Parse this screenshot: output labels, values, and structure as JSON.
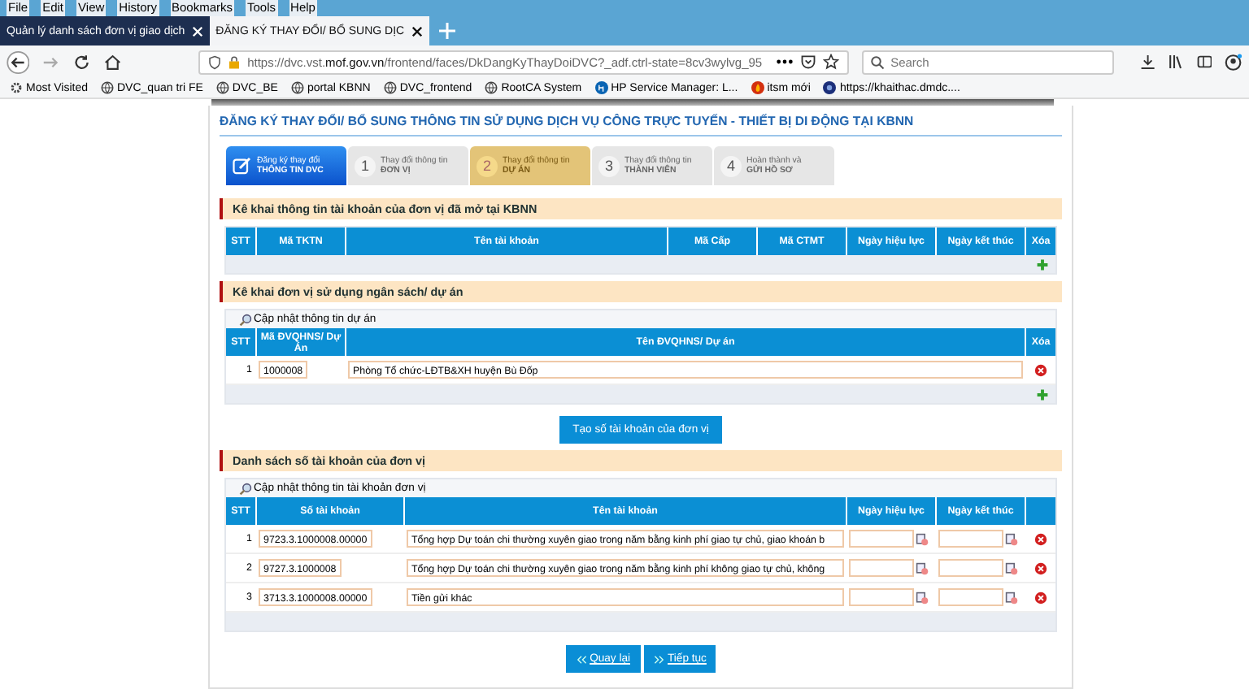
{
  "menu_bar": [
    "File",
    "Edit",
    "View",
    "History",
    "Bookmarks",
    "Tools",
    "Help"
  ],
  "tabs": [
    {
      "label": "Quản lý danh sách đơn vị giao dịch",
      "selected": false
    },
    {
      "label": "ĐĂNG KÝ THAY ĐỔI/ BỔ SUNG DỊC",
      "selected": true
    }
  ],
  "address_bar": {
    "url": "https://dvc.vst.**mof.gov.vn**/frontend/faces/DkDangKyThayDoiDVC?_adf.ctrl-state=8cv3wylvg_95"
  },
  "search": {
    "placeholder": "Search"
  },
  "bookmarks": [
    {
      "label": "Most Visited",
      "kind": "gear"
    },
    {
      "label": "DVC_quan tri FE",
      "kind": "globe"
    },
    {
      "label": "DVC_BE",
      "kind": "globe"
    },
    {
      "label": "portal KBNN",
      "kind": "globe"
    },
    {
      "label": "DVC_frontend",
      "kind": "globe"
    },
    {
      "label": "RootCA System",
      "kind": "globe"
    },
    {
      "label": "HP Service Manager: L...",
      "kind": "hp"
    },
    {
      "label": "itsm mới",
      "kind": "fire"
    },
    {
      "label": "https://khaithac.dmdc....",
      "kind": "dot"
    }
  ],
  "page_title": "ĐĂNG KÝ THAY ĐỔI/ BỔ SUNG THÔNG TIN SỬ DỤNG DỊCH VỤ CÔNG TRỰC TUYẾN - THIẾT BỊ DI ĐỘNG TẠI KBNN",
  "steps": [
    {
      "kind": "header",
      "line1": "Đăng ký thay đổi",
      "line2": "THÔNG TIN DVC",
      "selected": false
    },
    {
      "kind": "step",
      "number": "1",
      "line1": "Thay đổi thông tin",
      "line2": "ĐƠN VỊ",
      "selected": false
    },
    {
      "kind": "step",
      "number": "2",
      "line1": "Thay đổi thông tin",
      "line2": "DỰ ÁN",
      "selected": true
    },
    {
      "kind": "step",
      "number": "3",
      "line1": "Thay đổi thông tin",
      "line2": "THÀNH VIÊN",
      "selected": false
    },
    {
      "kind": "step",
      "number": "4",
      "line1": "Hoàn thành và",
      "line2": "GỬI HỒ SƠ",
      "selected": false
    }
  ],
  "sections": [
    {
      "title": "Kê khai thông tin tài khoản của đơn vị đã mở tại KBNN",
      "columns": [
        "STT",
        "Mã TKTN",
        "Tên tài khoản",
        "Mã Cấp",
        "Mã CTMT",
        "Ngày hiệu lực",
        "Ngày kết thúc",
        "Xóa"
      ],
      "addable": true
    },
    {
      "title": "Kê khai đơn vị sử dụng ngân sách/ dự án",
      "toolbar": "Cập nhật thông tin dự án",
      "columns": [
        "STT",
        "Mã ĐVQHNS/ Dự Án",
        "Tên ĐVQHNS/ Dự án",
        "Xóa"
      ],
      "rows": [
        {
          "stt": "1",
          "fields": [
            "1000008",
            "Phòng Tổ chức-LĐTB&XH huyện Bù Đốp"
          ]
        }
      ],
      "addable": true,
      "action": "Tạo số tài khoản của đơn vị"
    },
    {
      "title": "Danh sách số tài khoản của đơn vị",
      "toolbar": "Cập nhật thông tin tài khoản đơn vị",
      "columns": [
        "STT",
        "Số tài khoản",
        "Tên tài khoản",
        "Ngày hiệu lực",
        "Ngày kết thúc"
      ],
      "rows": [
        {
          "stt": "1",
          "fields": [
            "9723.3.1000008.00000",
            "Tổng hợp Dự toán chi thường xuyên giao trong năm bằng kinh phí giao tự chủ, giao khoán b"
          ]
        },
        {
          "stt": "2",
          "fields": [
            "9727.3.1000008",
            "Tổng hợp Dự toán chi thường xuyên giao trong năm bằng kinh phí không giao tự chủ, không"
          ]
        },
        {
          "stt": "3",
          "fields": [
            "3713.3.1000008.00000",
            "Tiền gửi khác"
          ]
        }
      ],
      "addable": false
    }
  ],
  "nav_buttons": [
    {
      "label": "Quay lại",
      "kind": "back"
    },
    {
      "label": "Tiếp tục",
      "kind": "next"
    }
  ]
}
